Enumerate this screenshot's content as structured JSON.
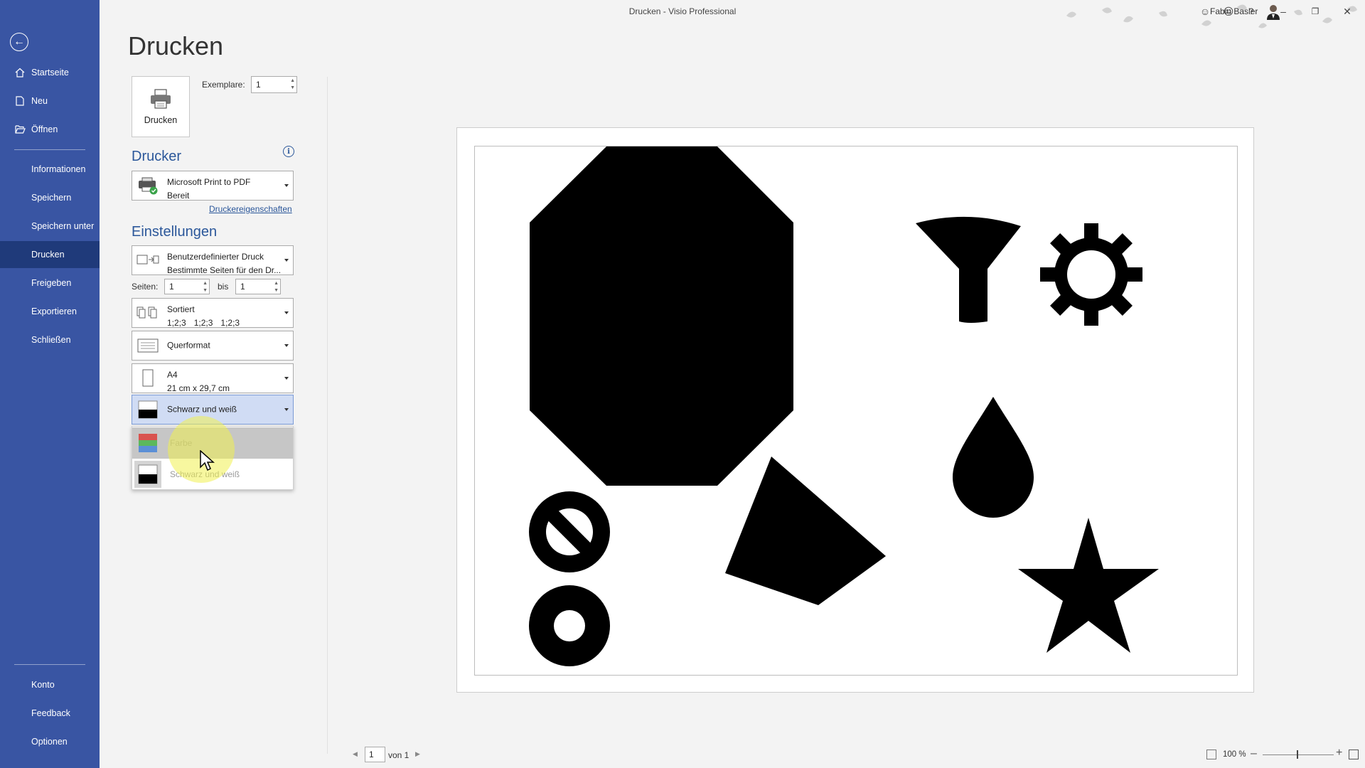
{
  "window": {
    "title": "Drucken  -  Visio Professional",
    "user_name": "Fabio Basler"
  },
  "sidebar": {
    "back_icon": "back-arrow-icon",
    "top_items": [
      {
        "label": "Startseite",
        "icon": "home-icon"
      },
      {
        "label": "Neu",
        "icon": "new-document-icon"
      },
      {
        "label": "Öffnen",
        "icon": "open-folder-icon"
      }
    ],
    "middle_items": [
      {
        "label": "Informationen"
      },
      {
        "label": "Speichern"
      },
      {
        "label": "Speichern unter"
      },
      {
        "label": "Drucken",
        "active": true
      },
      {
        "label": "Freigeben"
      },
      {
        "label": "Exportieren"
      },
      {
        "label": "Schließen"
      }
    ],
    "bottom_items": [
      {
        "label": "Konto"
      },
      {
        "label": "Feedback"
      },
      {
        "label": "Optionen"
      }
    ]
  },
  "print": {
    "heading": "Drucken",
    "print_button_label": "Drucken",
    "copies_label": "Exemplare:",
    "copies_value": "1",
    "printer_section": "Drucker",
    "printer": {
      "name": "Microsoft Print to PDF",
      "status": "Bereit"
    },
    "printer_properties_link": "Druckereigenschaften",
    "settings_section": "Einstellungen",
    "range": {
      "line1": "Benutzerdefinierter Druck",
      "line2": "Bestimmte Seiten für den Dr..."
    },
    "pages_label": "Seiten:",
    "pages_from": "1",
    "pages_to_label": "bis",
    "pages_to": "1",
    "collation": {
      "line1": "Sortiert",
      "sequence": [
        "1;2;3",
        "1;2;3",
        "1;2;3"
      ]
    },
    "orientation": "Querformat",
    "paper": {
      "line1": "A4",
      "line2": "21 cm x 29,7 cm"
    },
    "color_mode": "Schwarz und weiß",
    "color_options": [
      {
        "label": "Farbe",
        "hovered": true
      },
      {
        "label": "Schwarz und weiß",
        "hovered": false
      }
    ]
  },
  "preview": {
    "page_number": "1",
    "page_of": "von 1",
    "zoom": "100 %"
  }
}
